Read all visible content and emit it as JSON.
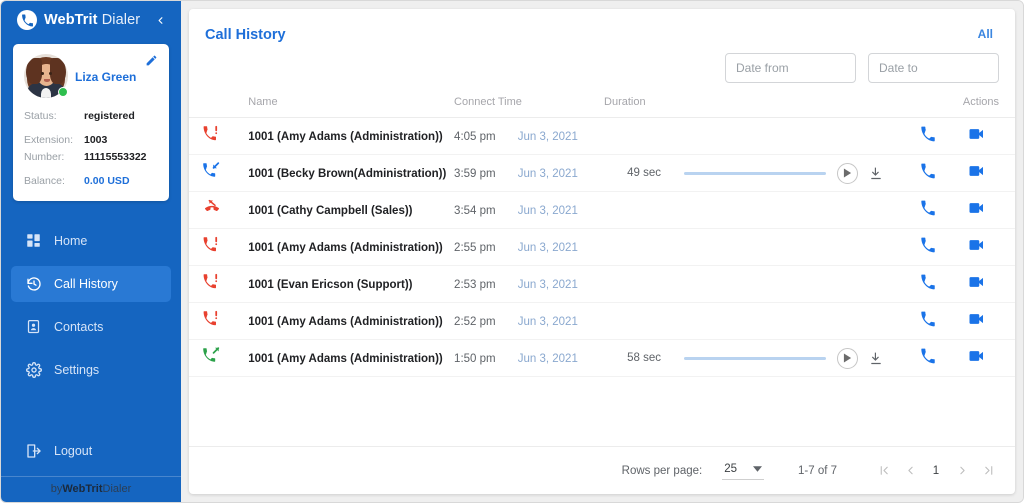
{
  "sidebar": {
    "brand": {
      "bold": "WebTrit",
      "regular": " Dialer",
      "logo_icon": "phone-circle-logo-icon"
    },
    "collapse_icon": "chevron-left-icon",
    "profile": {
      "name": "Liza Green",
      "edit_icon": "pencil-edit-icon",
      "presence": "online",
      "fields": [
        {
          "key": "Status:",
          "value": "registered",
          "accent": false
        },
        {
          "key": "Extension:",
          "value": "1003",
          "accent": false
        },
        {
          "key": "Number:",
          "value": "11115553322",
          "accent": false
        },
        {
          "key": "Balance:",
          "value": "0.00 USD",
          "accent": true
        }
      ]
    },
    "items": [
      {
        "label": "Home",
        "icon": "dashboard-grid-icon",
        "active": false
      },
      {
        "label": "Call History",
        "icon": "history-clock-icon",
        "active": true
      },
      {
        "label": "Contacts",
        "icon": "contact-card-icon",
        "active": false
      },
      {
        "label": "Settings",
        "icon": "gear-icon",
        "active": false
      }
    ],
    "logout": {
      "label": "Logout",
      "icon": "logout-arrow-icon"
    },
    "footer": {
      "prefix": "by ",
      "bold": "WebTrit",
      "regular": " Dialer"
    }
  },
  "main": {
    "title": "Call History",
    "all_label": "All",
    "filters": {
      "date_from_placeholder": "Date from",
      "date_from_value": "",
      "date_to_placeholder": "Date to",
      "date_to_value": ""
    },
    "table": {
      "columns": [
        "Name",
        "Connect Time",
        "Duration",
        "Actions"
      ],
      "rows": [
        {
          "call_type": "missed",
          "name": "1001 (Amy Adams (Administration))",
          "time": "4:05 pm",
          "date": "Jun 3, 2021",
          "duration": "",
          "has_recording": false
        },
        {
          "call_type": "incoming",
          "name": "1001 (Becky Brown(Administration))",
          "time": "3:59 pm",
          "date": "Jun 3, 2021",
          "duration": "49 sec",
          "has_recording": true
        },
        {
          "call_type": "declined",
          "name": "1001 (Cathy Campbell (Sales))",
          "time": "3:54 pm",
          "date": "Jun 3, 2021",
          "duration": "",
          "has_recording": false
        },
        {
          "call_type": "missed",
          "name": "1001 (Amy Adams (Administration))",
          "time": "2:55 pm",
          "date": "Jun 3, 2021",
          "duration": "",
          "has_recording": false
        },
        {
          "call_type": "missed",
          "name": "1001 (Evan Ericson (Support))",
          "time": "2:53 pm",
          "date": "Jun 3, 2021",
          "duration": "",
          "has_recording": false
        },
        {
          "call_type": "missed",
          "name": "1001 (Amy Adams (Administration))",
          "time": "2:52 pm",
          "date": "Jun 3, 2021",
          "duration": "",
          "has_recording": false
        },
        {
          "call_type": "outgoing",
          "name": "1001 (Amy Adams (Administration))",
          "time": "1:50 pm",
          "date": "Jun 3, 2021",
          "duration": "58 sec",
          "has_recording": true
        }
      ],
      "row_actions": {
        "audio_call_icon": "phone-call-icon",
        "video_call_icon": "video-camera-icon",
        "play_icon": "play-icon",
        "download_icon": "download-icon"
      }
    },
    "pagination": {
      "rows_per_page_label": "Rows per page:",
      "rows_per_page_value": "25",
      "range": "1-7 of 7",
      "current_page": "1",
      "first_icon": "first-page-icon",
      "prev_icon": "prev-page-icon",
      "next_icon": "next-page-icon",
      "last_icon": "last-page-icon"
    }
  },
  "colors": {
    "sidebar_bg": "#1565C0",
    "sidebar_active": "#2979d4",
    "accent_blue": "#1E6FD9",
    "action_blue": "#1a73e8",
    "missed_red": "#e8412f",
    "outgoing_green": "#2ca14a",
    "incoming_blue": "#1a73e8",
    "date_text": "#8aa8cf"
  }
}
